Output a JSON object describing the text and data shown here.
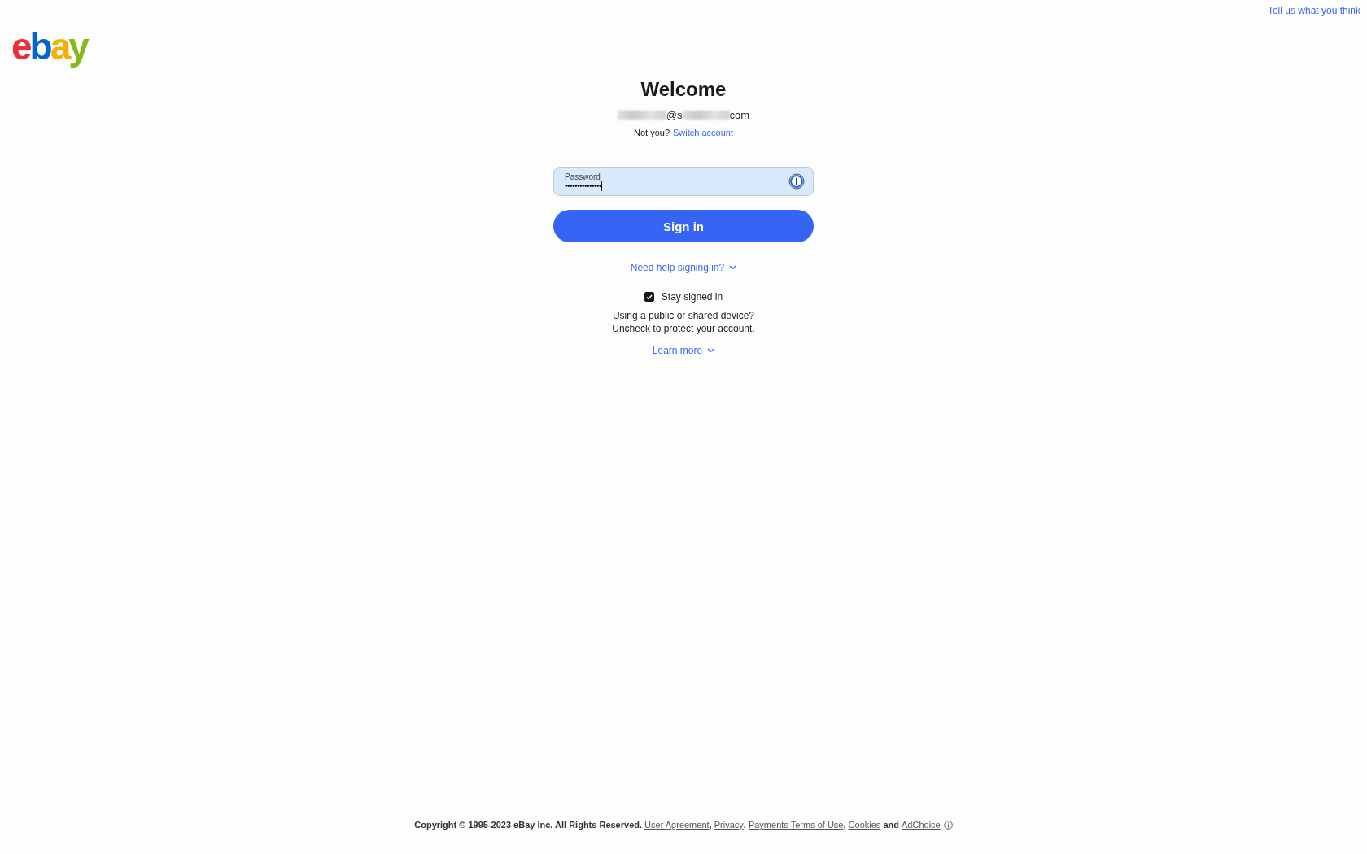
{
  "header_link": "Tell us what you think",
  "logo": [
    {
      "char": "e",
      "color": "#e53238"
    },
    {
      "char": "b",
      "color": "#0064d2"
    },
    {
      "char": "a",
      "color": "#f5af02"
    },
    {
      "char": "y",
      "color": "#86b817"
    }
  ],
  "title": "Welcome",
  "email_parts": [
    "@s",
    "com"
  ],
  "not_you": {
    "text": "Not you?",
    "link": "Switch account"
  },
  "password": {
    "label": "Password",
    "value": "•••••••••••••••"
  },
  "sign_in_button": "Sign in",
  "help_link": "Need help signing in?",
  "stay_signed_in": {
    "label": "Stay signed in",
    "checked": true
  },
  "notice": [
    "Using a public or shared device?",
    "Uncheck to protect your account."
  ],
  "learn_more": "Learn more",
  "footer": [
    {
      "kind": "text",
      "text": "Copyright © 1995-2023 eBay Inc. All Rights Reserved. "
    },
    {
      "kind": "link",
      "text": "User Agreement"
    },
    {
      "kind": "text",
      "text": ", "
    },
    {
      "kind": "link",
      "text": "Privacy"
    },
    {
      "kind": "text",
      "text": ", "
    },
    {
      "kind": "link",
      "text": "Payments Terms of Use"
    },
    {
      "kind": "text",
      "text": ", "
    },
    {
      "kind": "link",
      "text": "Cookies"
    },
    {
      "kind": "text",
      "text": " and "
    },
    {
      "kind": "link",
      "text": "AdChoice"
    }
  ]
}
